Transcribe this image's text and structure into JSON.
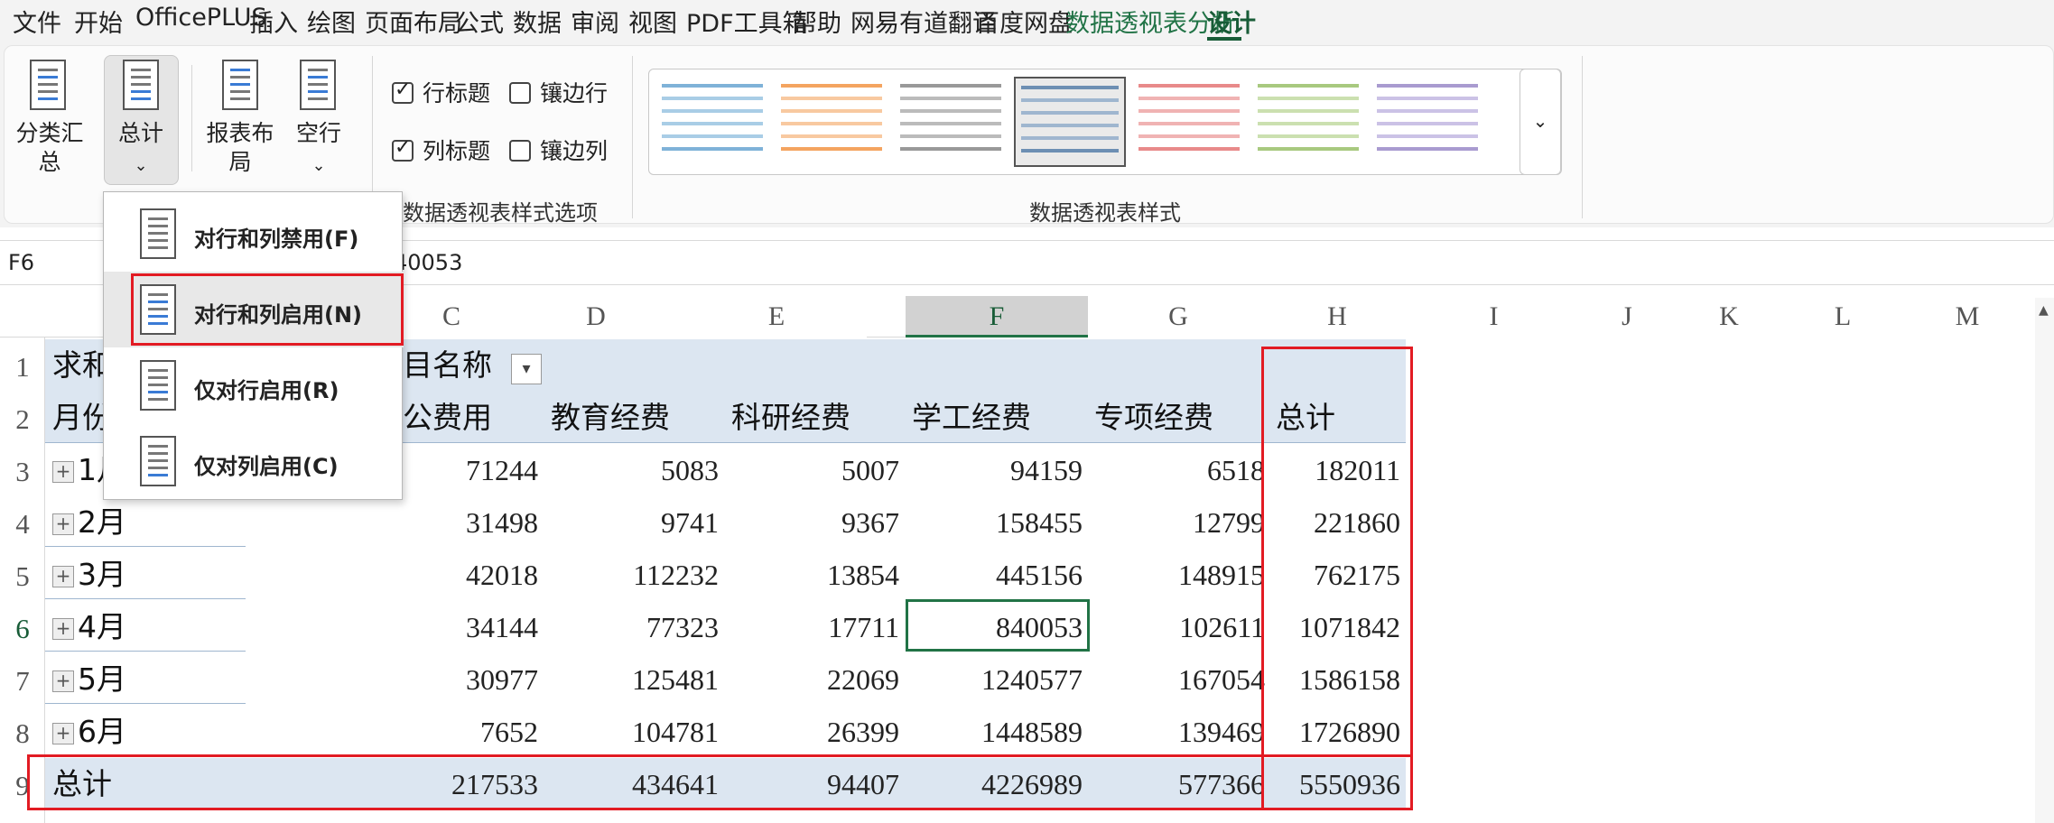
{
  "menu": {
    "tabs": [
      "文件",
      "开始",
      "OfficePLUS",
      "插入",
      "绘图",
      "页面布局",
      "公式",
      "数据",
      "审阅",
      "视图",
      "PDF工具箱",
      "帮助",
      "网易有道翻译",
      "百度网盘",
      "数据透视表分析",
      "设计"
    ]
  },
  "ribbon": {
    "subtotals_label": "分类汇总",
    "totals_label": "总计",
    "layout_label": "报表布局",
    "blank_rows_label": "空行",
    "row_headers": "行标题",
    "banded_rows": "镶边行",
    "col_headers": "列标题",
    "banded_cols": "镶边列",
    "style_options_group": "数据透视表样式选项",
    "styles_group": "数据透视表样式"
  },
  "formula_bar": {
    "name_box": "F6",
    "value_visible": "40053"
  },
  "totals_menu": {
    "items": [
      "对行和列禁用(F)",
      "对行和列启用(N)",
      "仅对行启用(R)",
      "仅对列启用(C)"
    ]
  },
  "columns": [
    "C",
    "D",
    "E",
    "F",
    "G",
    "H",
    "I",
    "J",
    "K",
    "L",
    "M"
  ],
  "rows": [
    "1",
    "2",
    "3",
    "4",
    "5",
    "6",
    "7",
    "8",
    "9"
  ],
  "pivot": {
    "value_label_visible": "求和",
    "col_field_visible": "目名称",
    "row_field_visible": "月份",
    "headers": [
      "公费用",
      "教育经费",
      "科研经费",
      "学工经费",
      "专项经费",
      "总计"
    ],
    "row_labels": [
      "1月",
      "2月",
      "3月",
      "4月",
      "5月",
      "6月"
    ],
    "data": [
      [
        "71244",
        "5083",
        "5007",
        "94159",
        "6518",
        "182011"
      ],
      [
        "31498",
        "9741",
        "9367",
        "158455",
        "12799",
        "221860"
      ],
      [
        "42018",
        "112232",
        "13854",
        "445156",
        "148915",
        "762175"
      ],
      [
        "34144",
        "77323",
        "17711",
        "840053",
        "102611",
        "1071842"
      ],
      [
        "30977",
        "125481",
        "22069",
        "1240577",
        "167054",
        "1586158"
      ],
      [
        "7652",
        "104781",
        "26399",
        "1448589",
        "139469",
        "1726890"
      ]
    ],
    "total_label": "总计",
    "totals": [
      "217533",
      "434641",
      "94407",
      "4226989",
      "577366",
      "5550936"
    ]
  }
}
